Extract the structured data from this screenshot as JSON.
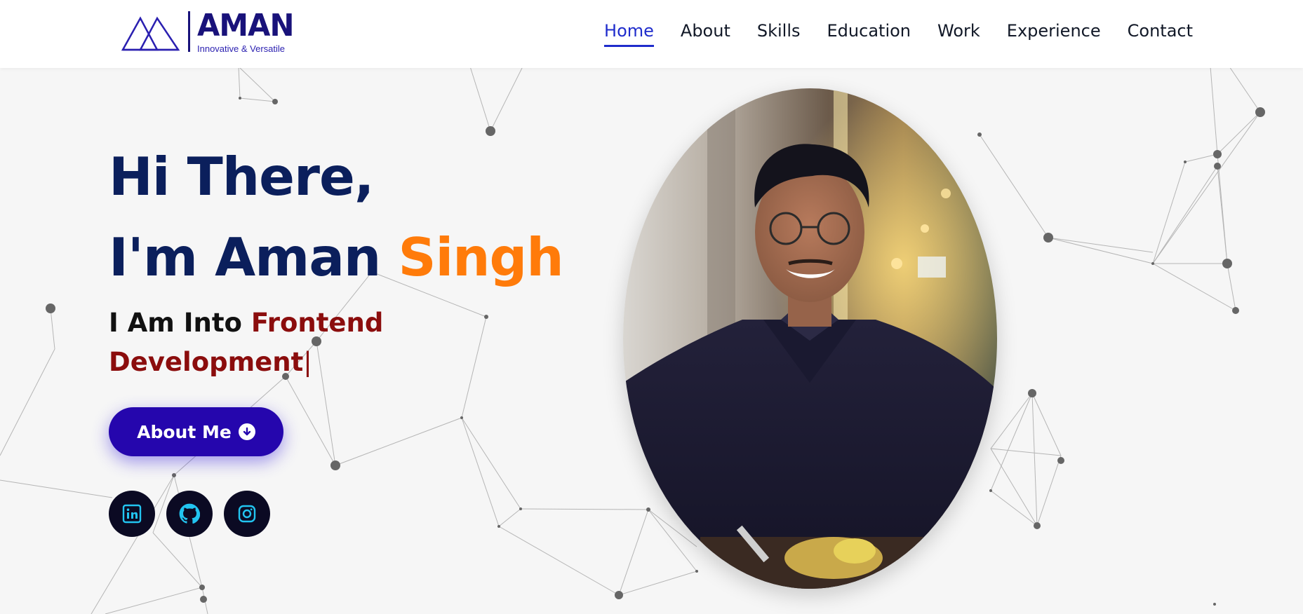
{
  "header": {
    "logo": {
      "name": "AMAN",
      "tagline": "Innovative & Versatile",
      "color": "#19127a"
    },
    "nav": [
      {
        "label": "Home",
        "active": true
      },
      {
        "label": "About",
        "active": false
      },
      {
        "label": "Skills",
        "active": false
      },
      {
        "label": "Education",
        "active": false
      },
      {
        "label": "Work",
        "active": false
      },
      {
        "label": "Experience",
        "active": false
      },
      {
        "label": "Contact",
        "active": false
      }
    ],
    "active_color": "#1f2ccc"
  },
  "hero": {
    "greeting": "Hi There,",
    "intro_prefix": "I'm Aman ",
    "intro_highlight": "Singh",
    "typed_prefix": "I Am Into ",
    "typed_role": "Frontend Development",
    "typed_cursor": "|",
    "cta_label": "About Me",
    "cta_icon": "arrow-down-circle-icon",
    "colors": {
      "heading": "#0b1f5c",
      "highlight": "#ff7b0a",
      "role": "#8b0d0d",
      "cta": "#2506ad"
    }
  },
  "socials": [
    {
      "name": "linkedin",
      "icon": "linkedin-icon"
    },
    {
      "name": "github",
      "icon": "github-icon"
    },
    {
      "name": "instagram",
      "icon": "instagram-icon"
    }
  ],
  "social_icon_color": "#22c4f0",
  "photo": {
    "alt": "portrait-photo"
  }
}
